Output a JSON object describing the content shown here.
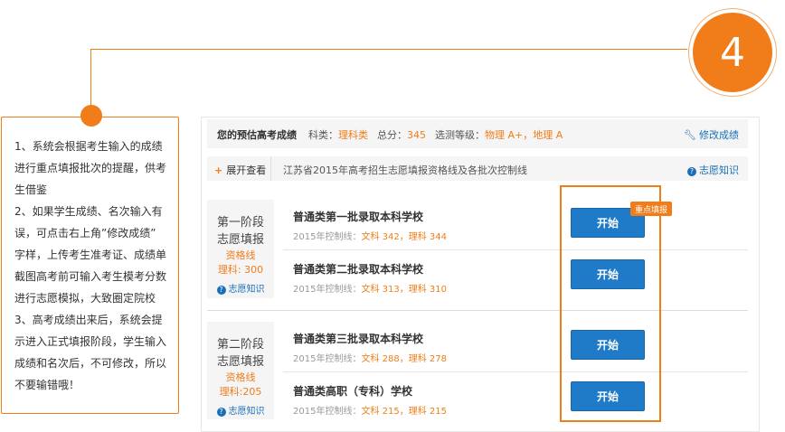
{
  "step_number": "4",
  "note_lines": [
    "1、系统会根据考生输入的成绩",
    "进行重点填报批次的提醒，供考",
    "生借鉴",
    "2、如果学生成绩、名次输入有",
    "误，可点击右上角”修改成绩”",
    "字样，上传考生准考证、成绩单",
    "截图高考前可输入考生模考分数",
    "进行志愿模拟，大致圈定院校",
    "3、高考成绩出来后，系统会提",
    "示进入正式填报阶段，学生输入",
    "成绩和名次后，不可修改，所以",
    "不要输错哦！"
  ],
  "header": {
    "title": "您的预估高考成绩",
    "subject_label": "科类：",
    "subject_value": "理科类",
    "total_label": "总分：",
    "total_value": "345",
    "grade_label": "选测等级：",
    "grade_value": "物理 A+，地理 A",
    "edit_label": "修改成绩"
  },
  "bar": {
    "expand_label": "展开查看",
    "text": "江苏省2015年高考招生志愿填报资格线及各批次控制线",
    "help_label": "志愿知识"
  },
  "stages": [
    {
      "name_line1": "第一阶段",
      "name_line2": "志愿填报",
      "qual_label": "资格线",
      "qual_value": "理科: 300",
      "help_label": "志愿知识"
    },
    {
      "name_line1": "第二阶段",
      "name_line2": "志愿填报",
      "qual_label": "资格线",
      "qual_value": "理科:205",
      "help_label": "志愿知识"
    }
  ],
  "batches": [
    {
      "title": "普通类第一批录取本科学校",
      "score_prefix": "2015年控制线：",
      "score_values": "文科 342，理科 344",
      "button": "开始"
    },
    {
      "title": "普通类第二批录取本科学校",
      "score_prefix": "2015年控制线：",
      "score_values": "文科 313，理科 310",
      "button": "开始"
    },
    {
      "title": "普通类第三批录取本科学校",
      "score_prefix": "2015年控制线：",
      "score_values": "文科 288，理科 278",
      "button": "开始"
    },
    {
      "title": "普通类高职（专科）学校",
      "score_prefix": "2015年控制线：",
      "score_values": "文科 215，理科 215",
      "button": "开始"
    }
  ],
  "highlight_tag": "重点填报",
  "colors": {
    "accent": "#f07d1a",
    "button": "#1f7bc8",
    "link": "#1a6fb8"
  }
}
